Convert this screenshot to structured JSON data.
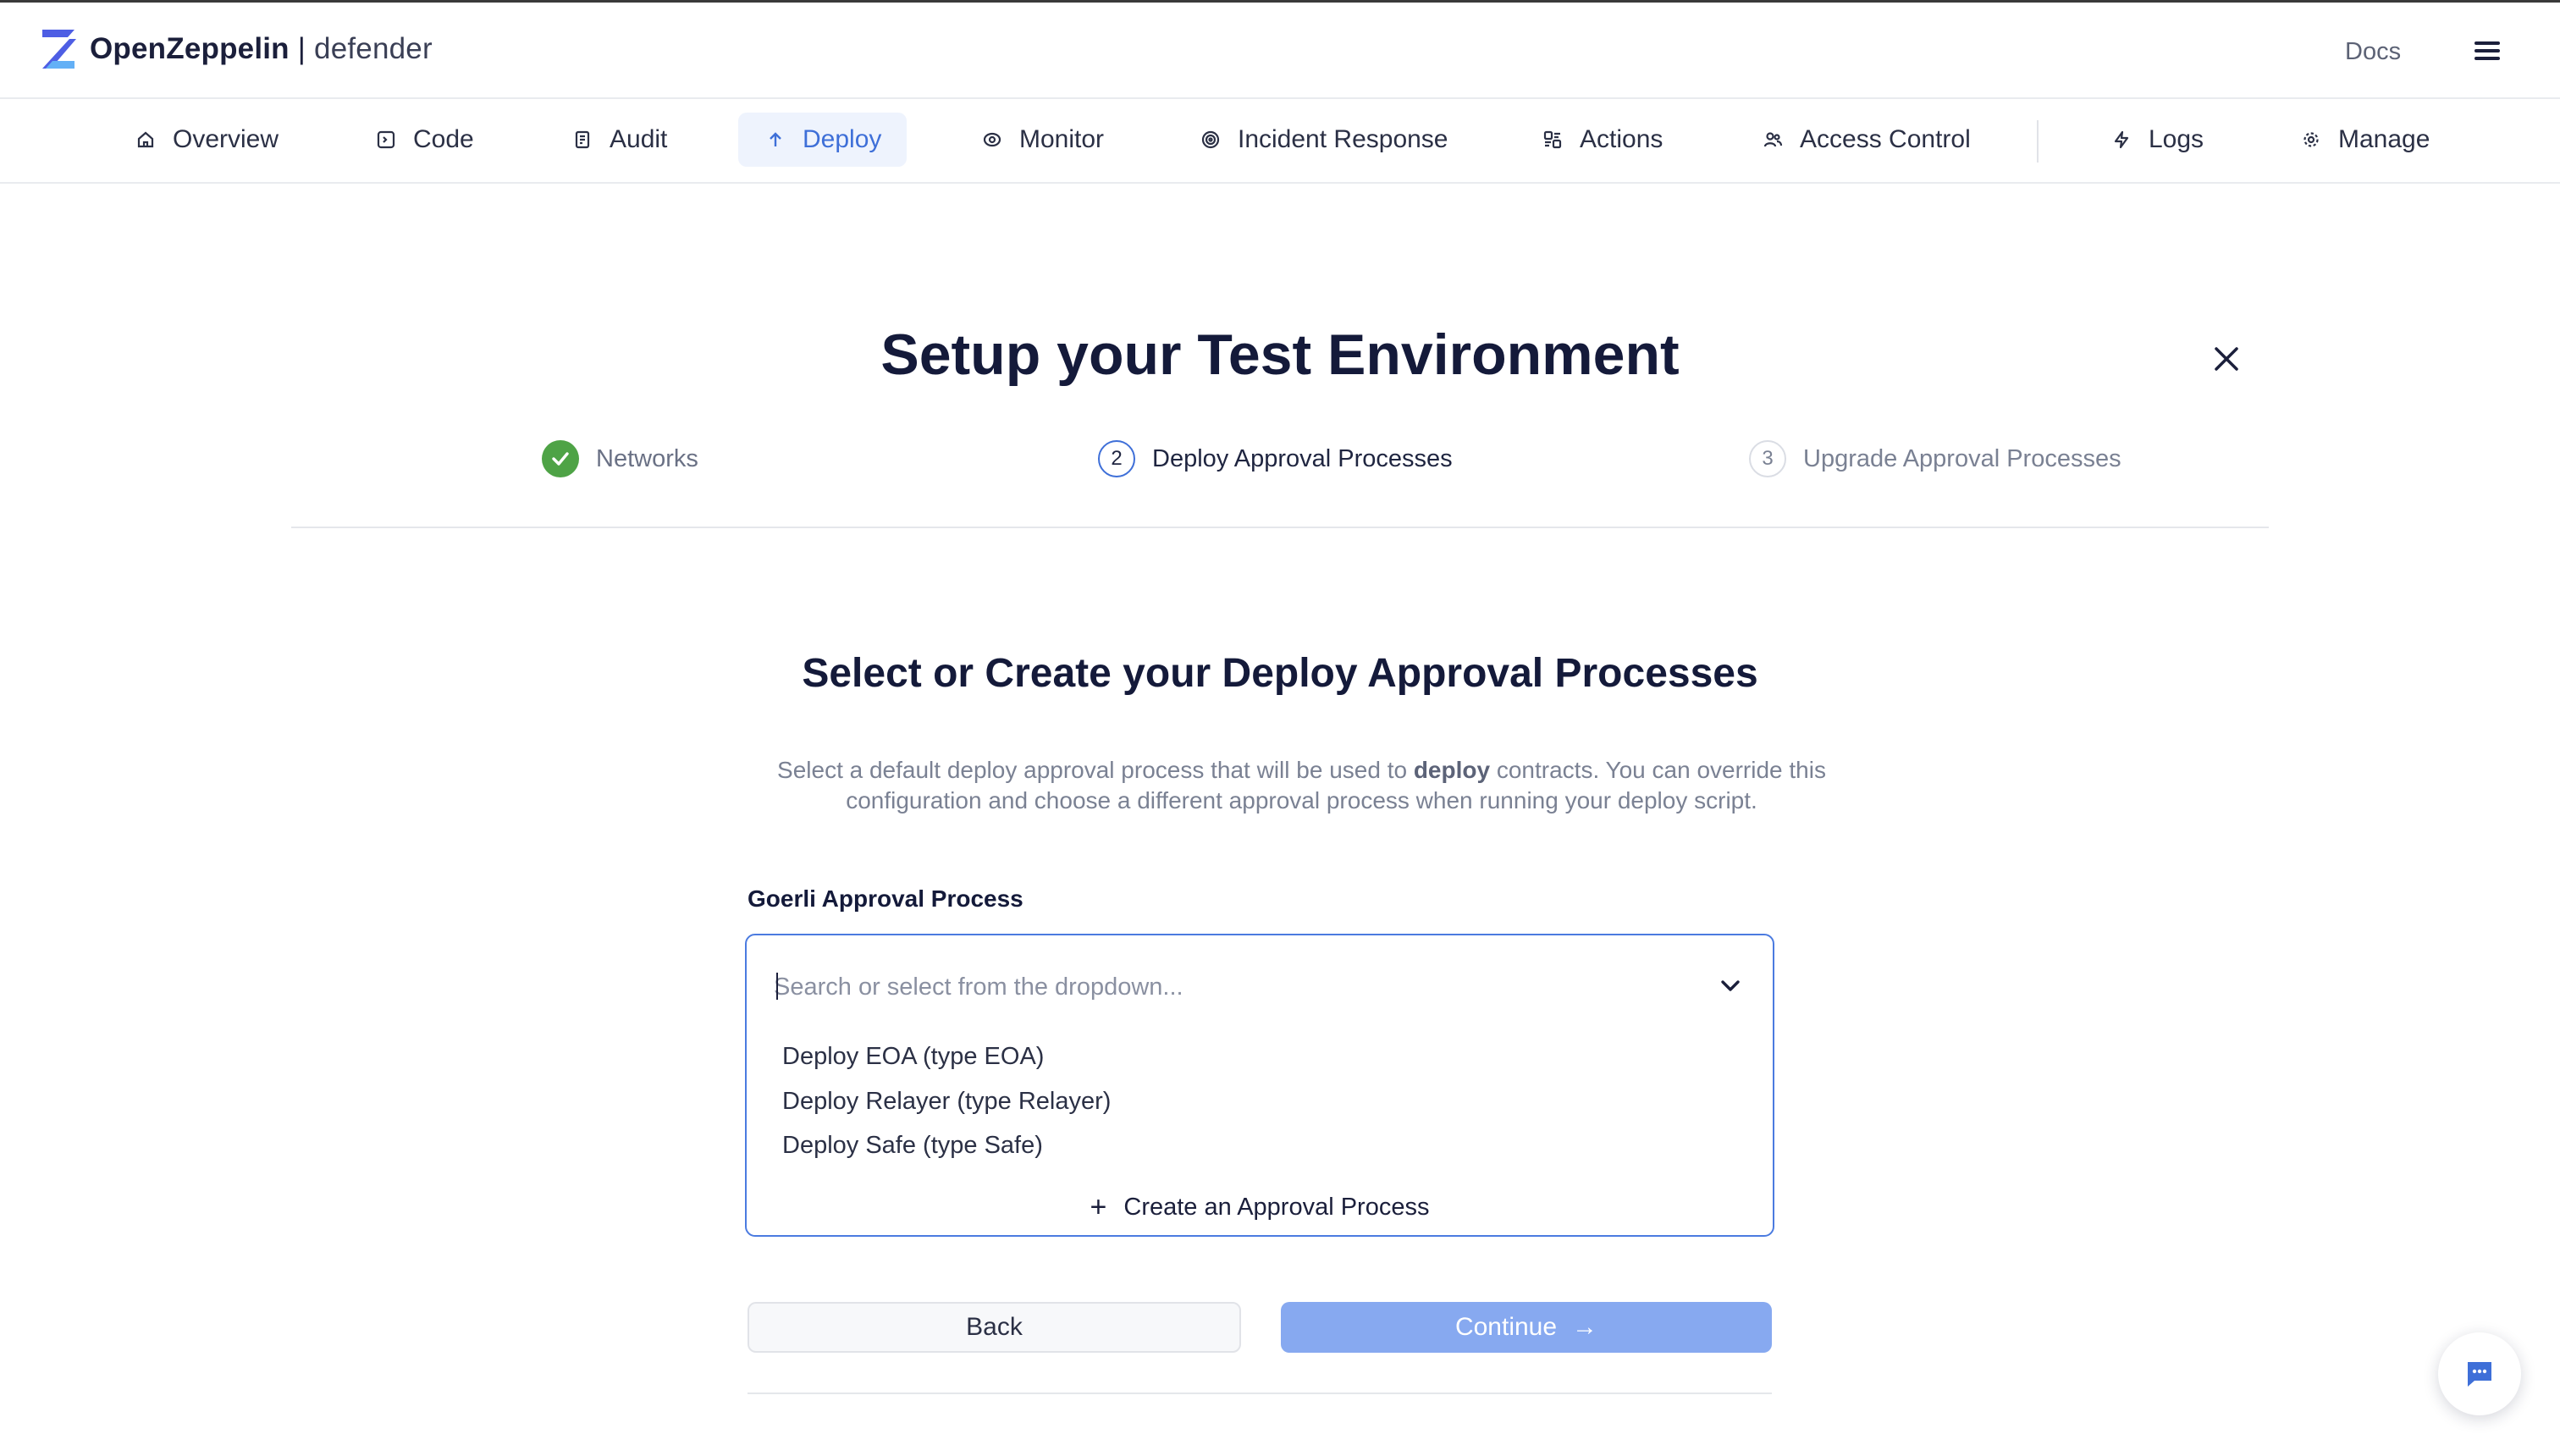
{
  "header": {
    "brand": "OpenZeppelin",
    "separator": "|",
    "product": "defender",
    "docs_label": "Docs",
    "menu_icon": "hamburger-menu-icon"
  },
  "nav": {
    "items": [
      {
        "label": "Overview",
        "icon": "home-icon",
        "active": false
      },
      {
        "label": "Code",
        "icon": "code-icon",
        "active": false
      },
      {
        "label": "Audit",
        "icon": "audit-icon",
        "active": false
      },
      {
        "label": "Deploy",
        "icon": "arrow-up-icon",
        "active": true
      },
      {
        "label": "Monitor",
        "icon": "eye-icon",
        "active": false
      },
      {
        "label": "Incident Response",
        "icon": "target-icon",
        "active": false
      },
      {
        "label": "Actions",
        "icon": "actions-icon",
        "active": false
      },
      {
        "label": "Access Control",
        "icon": "users-icon",
        "active": false
      },
      {
        "label": "Logs",
        "icon": "bolt-icon",
        "active": false
      },
      {
        "label": "Manage",
        "icon": "gear-icon",
        "active": false
      }
    ]
  },
  "wizard": {
    "title": "Setup your Test Environment",
    "steps": [
      {
        "label": "Networks",
        "status": "done"
      },
      {
        "label": "Deploy Approval Processes",
        "number": "2",
        "status": "current"
      },
      {
        "label": "Upgrade Approval Processes",
        "number": "3",
        "status": "upcoming"
      }
    ]
  },
  "section": {
    "title": "Select or Create your Deploy Approval Processes",
    "description_before": "Select a default deploy approval process that will be used to ",
    "description_bold": "deploy",
    "description_after": " contracts. You can override this configuration and choose a different approval process when running your deploy script."
  },
  "field": {
    "label": "Goerli Approval Process",
    "placeholder": "Search or select from the dropdown...",
    "value": "",
    "options": [
      "Deploy EOA (type EOA)",
      "Deploy Relayer (type Relayer)",
      "Deploy Safe (type Safe)"
    ],
    "create_label": "Create an Approval Process"
  },
  "buttons": {
    "back": "Back",
    "continue": "Continue"
  },
  "colors": {
    "accent": "#3e6fd8",
    "continue_bg": "#87a9f0",
    "success": "#4ea346",
    "dropdown_border": "#4b7be0"
  }
}
